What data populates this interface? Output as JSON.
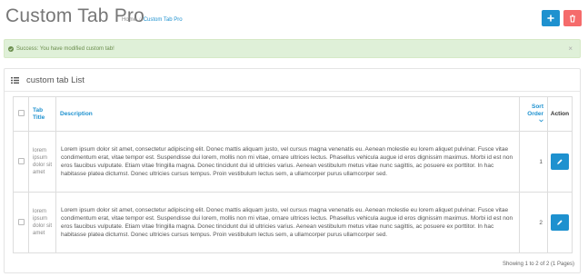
{
  "header": {
    "title": "Custom Tab Pro",
    "breadcrumb": [
      "Home",
      "Custom Tab Pro"
    ]
  },
  "colors": {
    "primary": "#1e91cf",
    "danger": "#f56b6b",
    "success_bg": "#dff0d8"
  },
  "alert": {
    "message": "Success: You have modified custom tab!",
    "close": "×"
  },
  "panel": {
    "heading": "custom tab List",
    "columns": {
      "title": "Tab Title",
      "description": "Description",
      "sort": "Sort Order",
      "action": "Action"
    },
    "rows": [
      {
        "title": "lorem ipsum dolor sit amet",
        "description": "Lorem ipsum dolor sit amet, consectetur adipiscing elit. Donec mattis aliquam justo, vel cursus magna venenatis eu. Aenean molestie eu lorem aliquet pulvinar. Fusce vitae condimentum erat, vitae tempor est. Suspendisse dui lorem, mollis non mi vitae, ornare ultrices lectus. Phasellus vehicula augue id eros dignissim maximus. Morbi id est non eros faucibus vulputate. Etiam vitae fringilla magna. Donec tincidunt dui id ultricies varius. Aenean vestibulum metus vitae nunc sagittis, ac posuere ex porttitor. In hac habitasse platea dictumst. Donec ultricies cursus tempus. Proin vestibulum lectus sem, a ullamcorper purus ullamcorper sed.",
        "sort_order": "1"
      },
      {
        "title": "lorem ipsum dolor sit amet",
        "description": "Lorem ipsum dolor sit amet, consectetur adipiscing elit. Donec mattis aliquam justo, vel cursus magna venenatis eu. Aenean molestie eu lorem aliquet pulvinar. Fusce vitae condimentum erat, vitae tempor est. Suspendisse dui lorem, mollis non mi vitae, ornare ultrices lectus. Phasellus vehicula augue id eros dignissim maximus. Morbi id est non eros faucibus vulputate. Etiam vitae fringilla magna. Donec tincidunt dui id ultricies varius. Aenean vestibulum metus vitae nunc sagittis, ac posuere ex porttitor. In hac habitasse platea dictumst. Donec ultricies cursus tempus. Proin vestibulum lectus sem, a ullamcorper purus ullamcorper sed.",
        "sort_order": "2"
      }
    ],
    "pagination": "Showing 1 to 2 of 2 (1 Pages)"
  }
}
